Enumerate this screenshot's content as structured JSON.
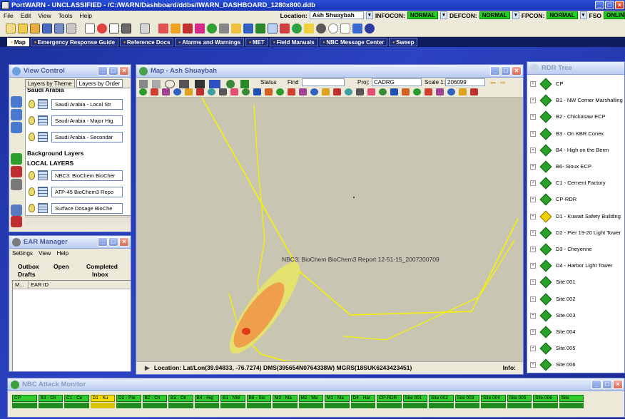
{
  "window": {
    "title": "PortWARN - UNCLASSIFIED - /C:/WARN/Dashboard/ddbs/IWARN_DASHBOARD_1280x800.ddb"
  },
  "menu": {
    "items": [
      "File",
      "Edit",
      "View",
      "Tools",
      "Help"
    ]
  },
  "status": {
    "location_label": "Location:",
    "location_value": "Ash Shuaybah",
    "infocon_label": "INFOCON:",
    "infocon_value": "NORMAL",
    "defcon_label": "DEFCON:",
    "defcon_value": "NORMAL",
    "fpcon_label": "FPCON:",
    "fpcon_value": "NORMAL",
    "fso_label": "FSO",
    "online_label": "ONLINE"
  },
  "tabs": [
    {
      "label": "Map",
      "active": true
    },
    {
      "label": "Emergency Response Guide",
      "active": false
    },
    {
      "label": "Reference Docs",
      "active": false
    },
    {
      "label": "Alarms and Warnings",
      "active": false
    },
    {
      "label": "MET",
      "active": false
    },
    {
      "label": "Field Manuals",
      "active": false
    },
    {
      "label": "NBC Message Center",
      "active": false
    },
    {
      "label": "Sweep",
      "active": false
    }
  ],
  "view_control": {
    "title": "View Control",
    "tab_theme": "Layers by Theme",
    "tab_order": "Layers by Order",
    "top_header": "Saudi Arabia",
    "saudi_layers": [
      "Saudi Arabia - Local Str",
      "Saudi Arabia - Major Hig",
      "Saudi Arabia - Secondar"
    ],
    "background_header": "Background Layers",
    "local_header": "LOCAL LAYERS",
    "local_layers": [
      "NBC3: BioChem BioCher",
      "ATP-45 BioChem3 Repo",
      "Surface Dosage BioChe"
    ]
  },
  "map": {
    "title": "Map - Ash Shuaybah",
    "status_btn": "Status",
    "find_label": "Find",
    "proj_label": "Proj:",
    "proj_value": "CADRG",
    "scale_label": "Scale 1:",
    "scale_value": "206099",
    "overlay_label": "NBC3: BioChem BioChem3 Report 12-51-15_2007200709",
    "location_text": "Location:  Lat/Lon(39.94833, -76.7274)  DMS(395654N0764338W)  MGRS(18SUK6243423451)",
    "info_label": "Info:"
  },
  "rdr_tree": {
    "title": "RDR Tree",
    "nodes": [
      {
        "label": "CP",
        "color": "green"
      },
      {
        "label": "B1 - NW Corner Marshalling Yard",
        "color": "green"
      },
      {
        "label": "B2 - Chickasaw ECP",
        "color": "green"
      },
      {
        "label": "B3 - On KBR Conex",
        "color": "green"
      },
      {
        "label": "B4 - High on the Berm",
        "color": "green"
      },
      {
        "label": "B6- Sioux ECP",
        "color": "green"
      },
      {
        "label": "C1 - Cement Factory",
        "color": "green"
      },
      {
        "label": "CP-RDR",
        "color": "green"
      },
      {
        "label": "D1 - Kuwait Safety Building",
        "color": "yellow"
      },
      {
        "label": "D2 - Pier 19-20 Light Tower",
        "color": "green"
      },
      {
        "label": "D3 - Cheyenne",
        "color": "green"
      },
      {
        "label": "D4 - Harbor Light Tower",
        "color": "green"
      },
      {
        "label": "Site 001",
        "color": "green"
      },
      {
        "label": "Site 002",
        "color": "green"
      },
      {
        "label": "Site 003",
        "color": "green"
      },
      {
        "label": "Site 004",
        "color": "green"
      },
      {
        "label": "Site 005",
        "color": "green"
      },
      {
        "label": "Site 006",
        "color": "green"
      }
    ]
  },
  "ear": {
    "title": "EAR Manager",
    "menu": [
      "Settings",
      "View",
      "Help"
    ],
    "tab_outbox": "Outbox",
    "tab_drafts": "Drafts",
    "tab_open": "Open",
    "tab_completed": "Completed",
    "tab_inbox": "Inbox",
    "col_m": "M...",
    "col_id": "EAR ID"
  },
  "nbc_monitor": {
    "title": "NBC Attack Monitor",
    "cells": [
      {
        "label": "CP",
        "color": "green"
      },
      {
        "label": "B3 - Ch",
        "color": "green"
      },
      {
        "label": "C1 - Ce",
        "color": "green"
      },
      {
        "label": "D1 - Ku",
        "color": "yellow"
      },
      {
        "label": "D2 - Pie",
        "color": "green"
      },
      {
        "label": "B2 - Ch",
        "color": "green"
      },
      {
        "label": "B3 - On",
        "color": "green"
      },
      {
        "label": "B4 - Hig",
        "color": "green"
      },
      {
        "label": "B1 - NW",
        "color": "green"
      },
      {
        "label": "B6 - Sio",
        "color": "green"
      },
      {
        "label": "M3 - Ma",
        "color": "green"
      },
      {
        "label": "M2 - Ma",
        "color": "green"
      },
      {
        "label": "M1 - Ma",
        "color": "green"
      },
      {
        "label": "D4 - Har",
        "color": "green"
      },
      {
        "label": "CP-RDR",
        "color": "green"
      },
      {
        "label": "Site 001",
        "color": "green"
      },
      {
        "label": "Site 002",
        "color": "green"
      },
      {
        "label": "Site 003",
        "color": "green"
      },
      {
        "label": "Site 004",
        "color": "green"
      },
      {
        "label": "Site 005",
        "color": "green"
      },
      {
        "label": "Site 006",
        "color": "green"
      },
      {
        "label": "Site",
        "color": "green"
      }
    ]
  }
}
